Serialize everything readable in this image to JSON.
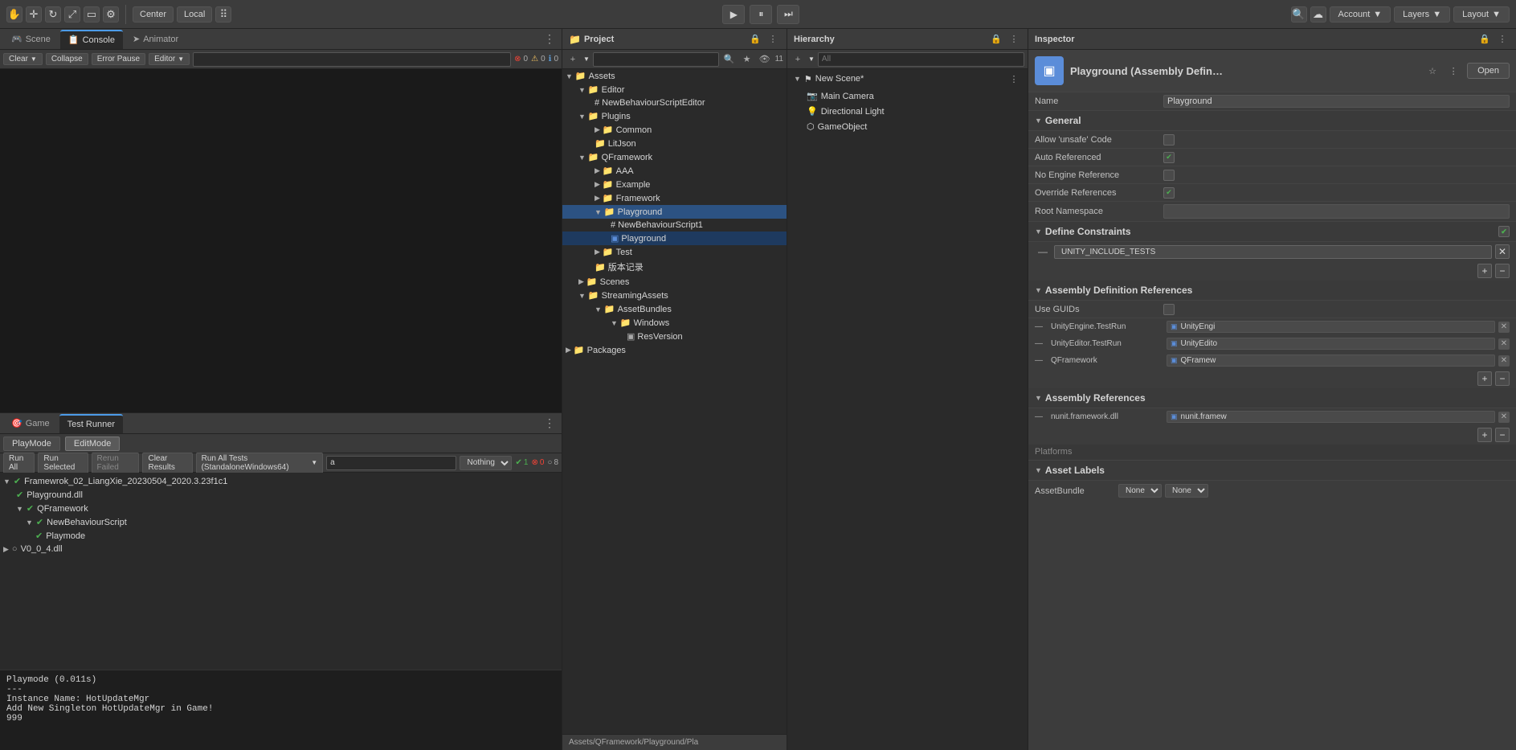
{
  "toolbar": {
    "tools": [
      "hand",
      "move",
      "rotate",
      "scale",
      "rect",
      "custom"
    ],
    "center_label": "Center",
    "local_label": "Local",
    "play_btn": "▶",
    "pause_btn": "⏸",
    "step_btn": "⏭",
    "account_label": "Account",
    "layers_label": "Layers",
    "layout_label": "Layout"
  },
  "console_tab": {
    "tabs": [
      "Scene",
      "Console",
      "Animator"
    ],
    "active_tab": "Console",
    "toolbar_items": [
      "Clear",
      "Collapse",
      "Error Pause",
      "Editor"
    ],
    "counts": {
      "errors": "0",
      "warnings": "0",
      "logs": "0"
    }
  },
  "game_test_panel": {
    "tabs": [
      "Game",
      "Test Runner"
    ],
    "active_tab": "Test Runner",
    "modes": [
      "PlayMode",
      "EditMode"
    ],
    "active_mode": "EditMode",
    "run_all": "Run All",
    "run_selected": "Run Selected",
    "rerun_failed": "Rerun Failed",
    "clear_results": "Clear Results",
    "run_all_tests": "Run All Tests (StandaloneWindows64)",
    "filter_placeholder": "a",
    "filter_option": "Nothing",
    "status": {
      "green": "1",
      "red": "0",
      "gray": "8"
    },
    "test_items": [
      {
        "id": 1,
        "indent": 0,
        "expand": "▼",
        "check": "✔",
        "label": "Framewrok_02_LiangXie_20230504_2020.3.23f1c1",
        "status": "pass"
      },
      {
        "id": 2,
        "indent": 1,
        "expand": "",
        "check": "✔",
        "label": "Playground.dll",
        "status": "pass"
      },
      {
        "id": 3,
        "indent": 2,
        "expand": "▼",
        "check": "✔",
        "label": "QFramework",
        "status": "pass"
      },
      {
        "id": 4,
        "indent": 3,
        "expand": "▼",
        "check": "✔",
        "label": "NewBehaviourScript",
        "status": "pass"
      },
      {
        "id": 5,
        "indent": 4,
        "expand": "",
        "check": "✔",
        "label": "Playmode",
        "status": "pass"
      },
      {
        "id": 6,
        "indent": 0,
        "expand": "▶",
        "check": "○",
        "label": "V0_0_4.dll",
        "status": "none"
      }
    ]
  },
  "console_output": {
    "lines": [
      "Playmode (0.011s)",
      "---",
      "Instance Name: HotUpdateMgr",
      "Add New Singleton HotUpdateMgr in Game!",
      "999"
    ]
  },
  "project_panel": {
    "title": "Project",
    "search_placeholder": "",
    "assets": {
      "label": "Assets",
      "children": [
        {
          "label": "Editor",
          "type": "folder",
          "children": [
            {
              "label": "NewBehaviourScriptEditor",
              "type": "script"
            }
          ]
        },
        {
          "label": "Plugins",
          "type": "folder",
          "children": [
            {
              "label": "Common",
              "type": "folder"
            },
            {
              "label": "LitJson",
              "type": "folder"
            }
          ]
        },
        {
          "label": "QFramework",
          "type": "folder",
          "children": [
            {
              "label": "AAA",
              "type": "folder"
            },
            {
              "label": "Example",
              "type": "folder"
            },
            {
              "label": "Framework",
              "type": "folder"
            },
            {
              "label": "Playground",
              "type": "folder",
              "selected": true,
              "children": [
                {
                  "label": "NewBehaviourScript1",
                  "type": "script"
                },
                {
                  "label": "Playground",
                  "type": "asmdef",
                  "selected_highlight": true
                }
              ]
            },
            {
              "label": "Test",
              "type": "folder"
            },
            {
              "label": "版本记录",
              "type": "folder"
            }
          ]
        },
        {
          "label": "Scenes",
          "type": "folder"
        },
        {
          "label": "StreamingAssets",
          "type": "folder",
          "children": [
            {
              "label": "AssetBundles",
              "type": "folder",
              "children": [
                {
                  "label": "Windows",
                  "type": "folder",
                  "children": [
                    {
                      "label": "ResVersion",
                      "type": "asset"
                    }
                  ]
                }
              ]
            }
          ]
        }
      ]
    },
    "packages": {
      "label": "Packages",
      "type": "folder"
    },
    "status_bar": "Assets/QFramework/Playground/Pla"
  },
  "hierarchy_panel": {
    "title": "Hierarchy",
    "scene_name": "New Scene*",
    "objects": [
      {
        "label": "Main Camera",
        "type": "camera"
      },
      {
        "label": "Directional Light",
        "type": "light"
      },
      {
        "label": "GameObject",
        "type": "gameobject"
      }
    ]
  },
  "inspector_panel": {
    "title": "Inspector",
    "object_name": "Playground (Assembly Defin…",
    "open_btn": "Open",
    "name_label": "Name",
    "name_value": "Playground",
    "general_section": "General",
    "fields": [
      {
        "label": "Allow 'unsafe' Code",
        "type": "checkbox",
        "checked": false
      },
      {
        "label": "Auto Referenced",
        "type": "checkbox",
        "checked": true
      },
      {
        "label": "No Engine Reference",
        "type": "checkbox",
        "checked": false
      },
      {
        "label": "Override References",
        "type": "checkbox",
        "checked": true
      },
      {
        "label": "Root Namespace",
        "type": "text",
        "value": ""
      }
    ],
    "define_constraints_section": "Define Constraints",
    "define_constraints_check": true,
    "constraints": [
      {
        "value": "UNITY_INCLUDE_TESTS"
      }
    ],
    "assembly_def_refs_section": "Assembly Definition References",
    "use_guids_label": "Use GUIDs",
    "use_guids_checked": false,
    "assembly_refs": [
      {
        "label": "UnityEngine.TestRun",
        "value": "UnityEngi"
      },
      {
        "label": "UnityEditor.TestRun",
        "value": "UnityEdito"
      },
      {
        "label": "QFramework",
        "value": "QFramew"
      }
    ],
    "assembly_refs_section": "Assembly References",
    "assembly_refs2": [
      {
        "label": "nunit.framework.dll",
        "value": "nunit.framew"
      }
    ],
    "asset_labels_section": "Asset Labels",
    "asset_bundle_label": "AssetBundle",
    "asset_bundle_value": "None",
    "asset_bundle_value2": "None"
  }
}
